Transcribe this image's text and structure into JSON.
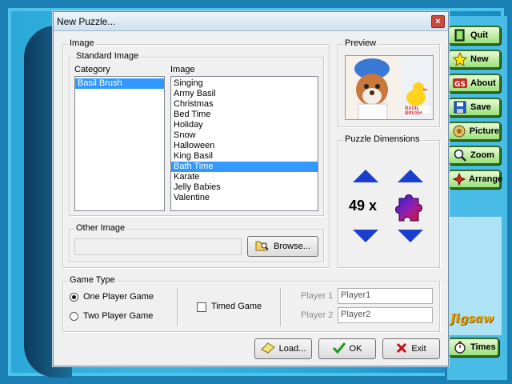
{
  "side_buttons": [
    {
      "label": "Quit",
      "icon": "exit-icon"
    },
    {
      "label": "New",
      "icon": "star-icon"
    },
    {
      "label": "About",
      "icon": "info-icon"
    },
    {
      "label": "Save",
      "icon": "floppy-icon"
    },
    {
      "label": "Picture",
      "icon": "picture-icon"
    },
    {
      "label": "Zoom",
      "icon": "magnifier-icon"
    },
    {
      "label": "Arrange",
      "icon": "arrange-icon"
    },
    {
      "label": "Times",
      "icon": "stopwatch-icon"
    }
  ],
  "app_logo_text": "Jigsaw",
  "dialog": {
    "title": "New Puzzle...",
    "close": "×",
    "image_group": {
      "legend": "Image",
      "standard_legend": "Standard Image",
      "category_header": "Category",
      "image_header": "Image",
      "categories": [
        "Basil Brush"
      ],
      "selected_category": "Basil Brush",
      "images": [
        "Singing",
        "Army Basil",
        "Christmas",
        "Bed Time",
        "Holiday",
        "Snow",
        "Halloween",
        "King Basil",
        "Bath Time",
        "Karate",
        "Jelly Babies",
        "Valentine"
      ],
      "selected_image": "Bath Time",
      "other_legend": "Other Image",
      "other_value": "",
      "browse_label": "Browse..."
    },
    "preview": {
      "legend": "Preview",
      "badge_text": "BASIL BRUSH"
    },
    "dimensions": {
      "legend": "Puzzle Dimensions",
      "value": "49 x"
    },
    "game_type": {
      "legend": "Game Type",
      "one_player": "One Player Game",
      "two_player": "Two Player Game",
      "selected": "one_player",
      "timed_label": "Timed Game",
      "timed_checked": false,
      "player1_label": "Player 1",
      "player1_value": "Player1",
      "player2_label": "Player 2",
      "player2_value": "Player2"
    },
    "buttons": {
      "load": "Load...",
      "ok": "OK",
      "exit": "Exit"
    }
  },
  "colors": {
    "selection": "#3399ff",
    "arrow": "#1a3fcf",
    "side_button": "#9be07a",
    "close": "#c94a3e"
  }
}
